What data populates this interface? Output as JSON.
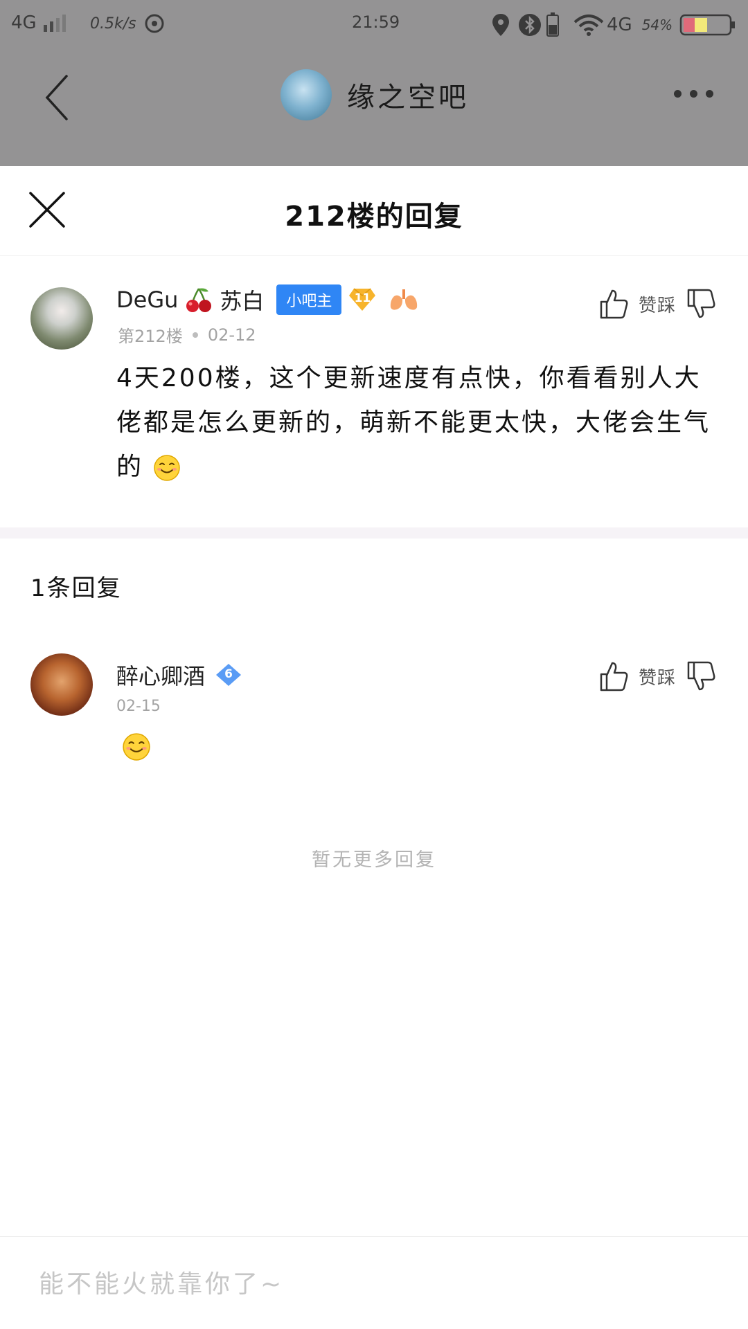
{
  "status_bar": {
    "network_left": "4G",
    "speed": "0.5k/s",
    "time": "21:59",
    "network_right": "4G",
    "battery_percent": "54%",
    "battery_level": 0.54
  },
  "background_page": {
    "forum_title": "缘之空吧",
    "back_icon": "chevron-left-icon",
    "more_icon": "more-horizontal-icon"
  },
  "sheet": {
    "title": "212楼的回复",
    "close_icon": "close-icon"
  },
  "post": {
    "username": "DeGu",
    "username_suffix": "苏白",
    "badge": "小吧主",
    "level": "11",
    "floor": "第212楼",
    "date": "02-12",
    "content": "4天200楼，这个更新速度有点快，你看看别人大佬都是怎么更新的，萌新不能更太快，大佬会生气的",
    "vote_label": "赞踩",
    "icons": [
      "cherry-icon",
      "level-gem-icon",
      "lungs-icon",
      "thumbs-up-icon",
      "thumbs-down-icon",
      "smile-emoji-icon"
    ]
  },
  "replies_header": "1条回复",
  "reply": {
    "username": "醉心卿酒",
    "level": "6",
    "date": "02-15",
    "vote_label": "赞踩"
  },
  "no_more_text": "暂无更多回复",
  "input": {
    "placeholder": "能不能火就靠你了~",
    "value": ""
  },
  "colors": {
    "overlay_gray": "#949394",
    "badge_blue": "#2f86f5",
    "gem_gold": "#f7b42c",
    "gem_blue": "#5a9cf5",
    "divider": "#f6f3f7"
  }
}
